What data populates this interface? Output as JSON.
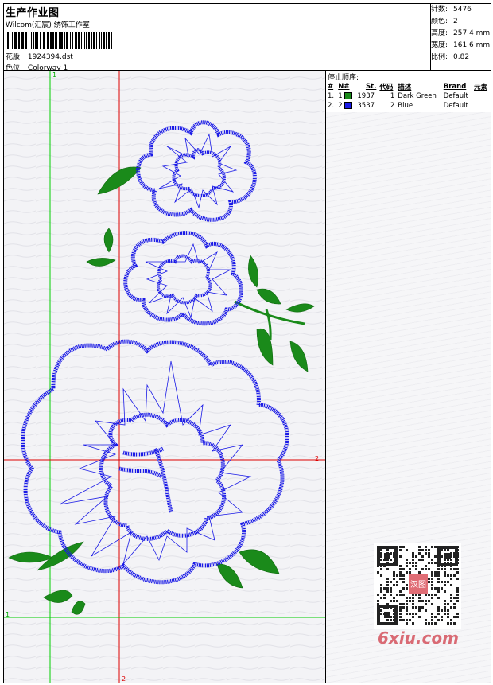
{
  "header": {
    "title": "生产作业图",
    "brand": "Wilcom(汇宸) 绣饰工作室",
    "design_label": "花版:",
    "design_value": "1924394.dst",
    "colorway_label": "色位:",
    "colorway_value": "Colorway 1"
  },
  "stats": [
    {
      "label": "针数:",
      "value": "5476"
    },
    {
      "label": "颜色:",
      "value": "2"
    },
    {
      "label": "高度:",
      "value": "257.4 mm"
    },
    {
      "label": "宽度:",
      "value": "161.6 mm"
    },
    {
      "label": "比例:",
      "value": "0.82"
    }
  ],
  "stop_sequence": {
    "title": "停止顺序:",
    "columns": [
      "#",
      "N#",
      "St.",
      "代码",
      "描述",
      "Brand",
      "元素"
    ],
    "rows": [
      {
        "idx": "1.",
        "n": "1",
        "color": "#1a8a1a",
        "stitches": "1937",
        "code": "1",
        "desc": "Dark Green",
        "brand": "Default"
      },
      {
        "idx": "2.",
        "n": "2",
        "color": "#1a1ae6",
        "stitches": "3537",
        "code": "2",
        "desc": "Blue",
        "brand": "Default"
      }
    ]
  },
  "guides": {
    "v1_label": "1",
    "v2_label": "2",
    "h1_label": "1",
    "h2_label": "2"
  },
  "watermark": {
    "text": "6xiu.com",
    "stamp_text": "汉图"
  },
  "colors": {
    "stitch_blue": "#1a1ae6",
    "stitch_green": "#1a8a1a",
    "guide_green": "#00cc00",
    "guide_red": "#dd0000"
  }
}
